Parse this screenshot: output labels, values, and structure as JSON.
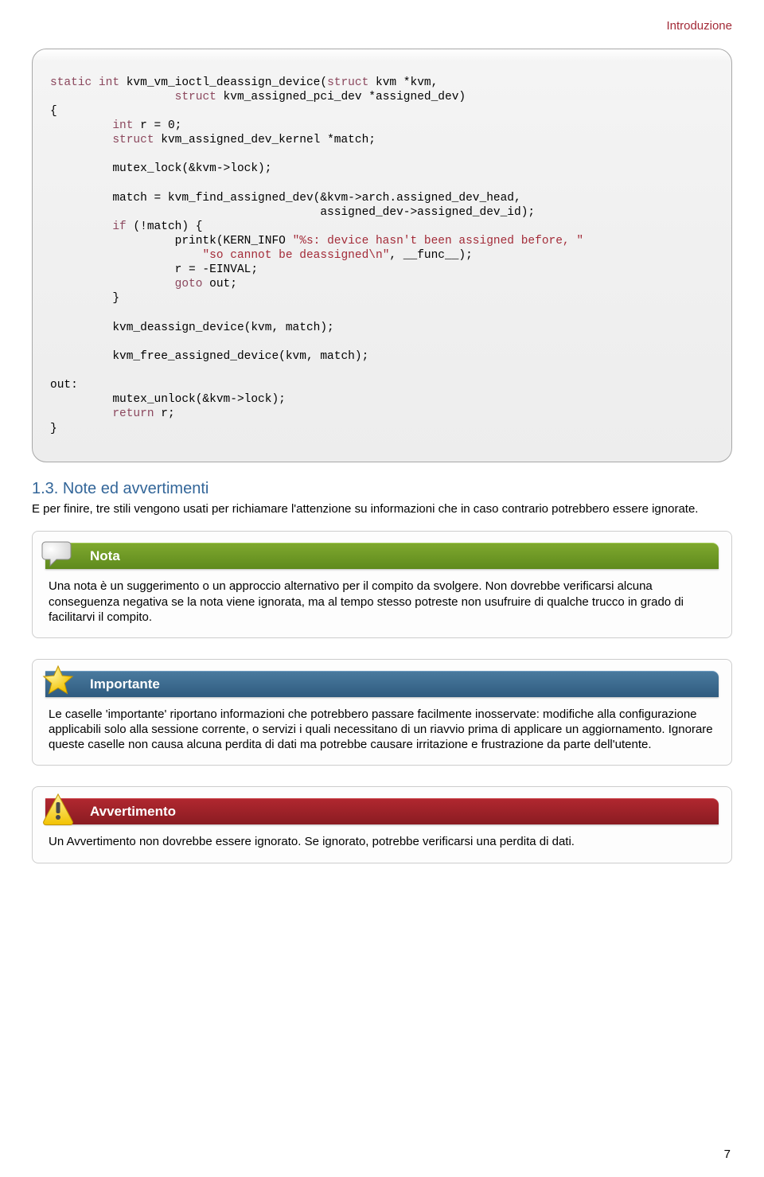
{
  "header": {
    "section": "Introduzione"
  },
  "code": {
    "l1a": "static",
    "l1b": " int",
    "l1c": " kvm_vm_ioctl_deassign_device(",
    "l1d": "struct",
    "l1e": " kvm *kvm,",
    "l2a": "                  ",
    "l2b": "struct",
    "l2c": " kvm_assigned_pci_dev *assigned_dev)",
    "l3": "{",
    "l4a": "         ",
    "l4b": "int",
    "l4c": " r = 0;",
    "l5a": "         ",
    "l5b": "struct",
    "l5c": " kvm_assigned_dev_kernel *match;",
    "l6": "",
    "l7": "         mutex_lock(&kvm->lock);",
    "l8": "",
    "l9": "         match = kvm_find_assigned_dev(&kvm->arch.assigned_dev_head,",
    "l10": "                                       assigned_dev->assigned_dev_id);",
    "l11a": "         ",
    "l11b": "if",
    "l11c": " (!match) {",
    "l12a": "                  printk(KERN_INFO ",
    "l12b": "\"%s: device hasn't been assigned before, \"",
    "l13a": "                      ",
    "l13b": "\"so cannot be deassigned",
    "l13c": "\\n",
    "l13d": "\"",
    "l13e": ", __func__);",
    "l14": "                  r = -EINVAL;",
    "l15a": "                  ",
    "l15b": "goto",
    "l15c": " out;",
    "l16": "         }",
    "l17": "",
    "l18": "         kvm_deassign_device(kvm, match);",
    "l19": "",
    "l20": "         kvm_free_assigned_device(kvm, match);",
    "l21": "",
    "l22": "out:",
    "l23": "         mutex_unlock(&kvm->lock);",
    "l24a": "         ",
    "l24b": "return",
    "l24c": " r;",
    "l25": "}"
  },
  "section_heading": "1.3. Note ed avvertimenti",
  "section_para": "E per finire, tre stili vengono usati per richiamare l'attenzione su informazioni che in caso contrario potrebbero essere ignorate.",
  "note": {
    "title": "Nota",
    "body": "Una nota è un suggerimento o un approccio alternativo per il compito da svolgere. Non dovrebbe verificarsi alcuna conseguenza negativa se la nota viene ignorata, ma al tempo stesso potreste non usufruire di qualche trucco in grado di facilitarvi il compito."
  },
  "important": {
    "title": "Importante",
    "body": "Le caselle 'importante' riportano informazioni che potrebbero passare facilmente inosservate: modifiche alla configurazione applicabili solo alla sessione corrente, o servizi i quali necessitano di un riavvio prima di applicare un aggiornamento. Ignorare queste caselle non causa alcuna perdita di dati ma potrebbe causare irritazione e frustrazione da parte dell'utente."
  },
  "warning": {
    "title": "Avvertimento",
    "body": "Un Avvertimento non dovrebbe essere ignorato. Se ignorato, potrebbe verificarsi una perdita di dati."
  },
  "page_number": "7"
}
